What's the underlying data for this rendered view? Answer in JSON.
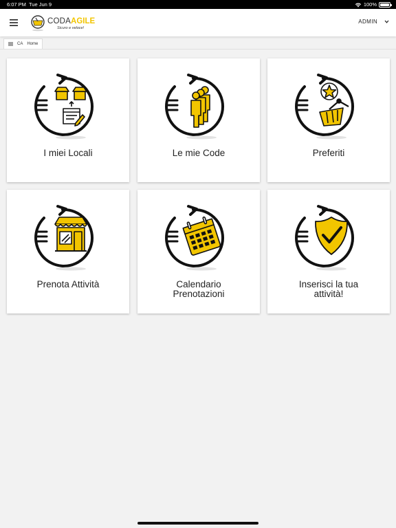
{
  "status": {
    "time": "6:07 PM",
    "date": "Tue Jun 9",
    "battery": "100%"
  },
  "header": {
    "brand_part1": "CODA",
    "brand_part2": "AGILE",
    "tagline": "Sicuro e veloce!",
    "user": "ADMIN"
  },
  "breadcrumb": {
    "root": "CA",
    "current": "Home"
  },
  "colors": {
    "accent": "#f2c500",
    "icon_stroke": "#111111"
  },
  "tiles": [
    {
      "label": "I miei Locali",
      "icon": "shops-icon"
    },
    {
      "label": "Le mie Code",
      "icon": "queue-people-icon"
    },
    {
      "label": "Preferiti",
      "icon": "favorites-basket-icon"
    },
    {
      "label": "Prenota Attività",
      "icon": "storefront-icon"
    },
    {
      "label": "Calendario\nPrenotazioni",
      "icon": "calendar-icon"
    },
    {
      "label": "Inserisci la tua\nattività!",
      "icon": "shield-check-icon"
    }
  ]
}
